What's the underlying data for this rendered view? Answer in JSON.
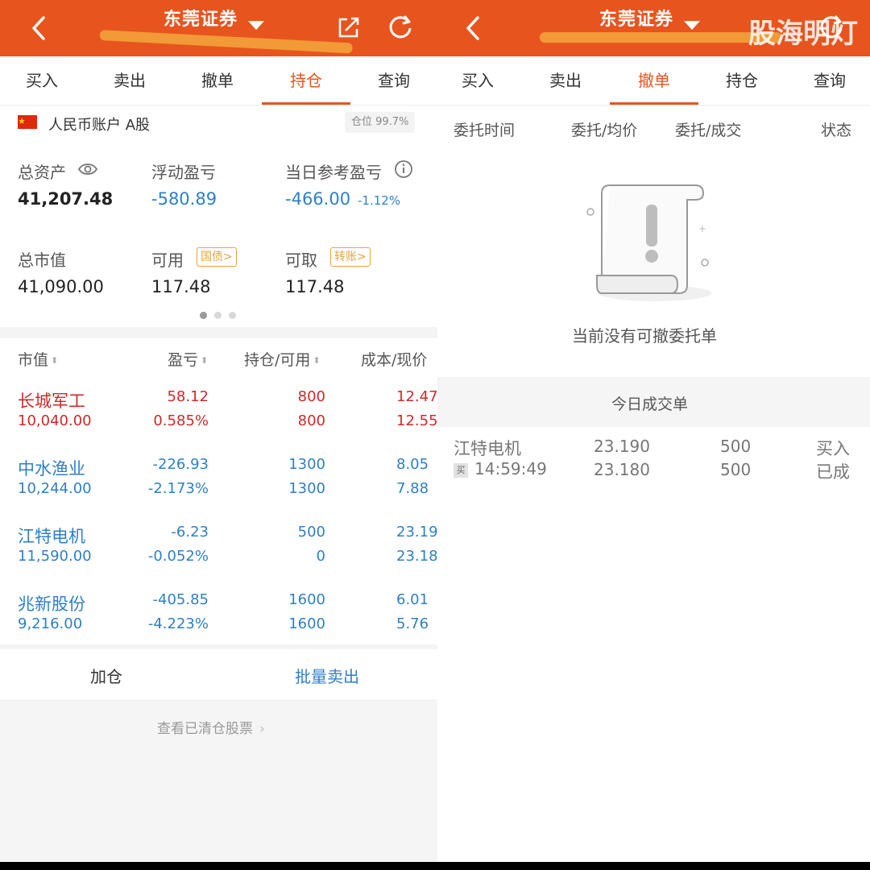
{
  "left": {
    "title": "东莞证券",
    "tabs": [
      "买入",
      "卖出",
      "撤单",
      "持仓",
      "查询"
    ],
    "active_tab": "持仓",
    "account": {
      "flag": "cn-flag-icon",
      "label": "人民币账户 A股",
      "position": "仓位 99.7%"
    },
    "summary": {
      "total_assets_label": "总资产",
      "total_assets": "41,207.48",
      "floating_pnl_label": "浮动盈亏",
      "floating_pnl": "-580.89",
      "today_pnl_label": "当日参考盈亏",
      "today_pnl": "-466.00",
      "today_pnl_pct": "-1.12%",
      "market_value_label": "总市值",
      "market_value": "41,090.00",
      "available_label": "可用",
      "available_tag": "国债>",
      "available": "117.48",
      "withdrawable_label": "可取",
      "withdrawable_tag": "转账>",
      "withdrawable": "117.48"
    },
    "columns": [
      "市值",
      "盈亏",
      "持仓/可用",
      "成本/现价"
    ],
    "holdings": [
      {
        "name": "长城军工",
        "value": "10,040.00",
        "pnl": "58.12",
        "pnl_pct": "0.585%",
        "qty": "800",
        "avail": "800",
        "cost": "12.47",
        "price": "12.55",
        "color": "red"
      },
      {
        "name": "中水渔业",
        "value": "10,244.00",
        "pnl": "-226.93",
        "pnl_pct": "-2.173%",
        "qty": "1300",
        "avail": "1300",
        "cost": "8.05",
        "price": "7.88",
        "color": "blue"
      },
      {
        "name": "江特电机",
        "value": "11,590.00",
        "pnl": "-6.23",
        "pnl_pct": "-0.052%",
        "qty": "500",
        "avail": "0",
        "cost": "23.19",
        "price": "23.18",
        "color": "blue"
      },
      {
        "name": "兆新股份",
        "value": "9,216.00",
        "pnl": "-405.85",
        "pnl_pct": "-4.223%",
        "qty": "1600",
        "avail": "1600",
        "cost": "6.01",
        "price": "5.76",
        "color": "blue"
      }
    ],
    "actions": {
      "add": "加仓",
      "batch_sell": "批量卖出"
    },
    "cleared_link": "查看已清仓股票"
  },
  "right": {
    "title": "东莞证券",
    "tabs": [
      "买入",
      "卖出",
      "撤单",
      "持仓",
      "查询"
    ],
    "active_tab": "撤单",
    "columns": [
      "委托时间",
      "委托/均价",
      "委托/成交",
      "状态"
    ],
    "empty_text": "当前没有可撤委托单",
    "today_deals_title": "今日成交单",
    "deal": {
      "name": "江特电机",
      "side_badge": "买",
      "time": "14:59:49",
      "order_price": "23.190",
      "avg_price": "23.180",
      "order_qty": "500",
      "filled_qty": "500",
      "direction": "买入",
      "status": "已成"
    }
  },
  "watermark": "股海明灯",
  "colors": {
    "brand": "#e8541e",
    "down": "#2f7fc7",
    "up": "#cc2a2a"
  }
}
